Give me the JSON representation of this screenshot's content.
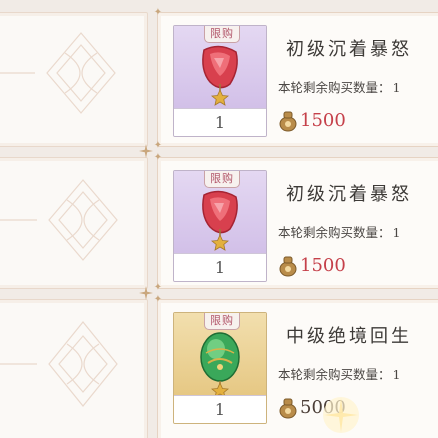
{
  "shop": {
    "items": [
      {
        "tag": "限购",
        "quantity": "1",
        "name": "初级沉着暴怒",
        "stock_label": "本轮剩余购买数量：",
        "stock_value": "1",
        "price": "1500",
        "rarity": "purple",
        "icon": "red-crystal-pendant-icon"
      },
      {
        "tag": "限购",
        "quantity": "1",
        "name": "初级沉着暴怒",
        "stock_label": "本轮剩余购买数量：",
        "stock_value": "1",
        "price": "1500",
        "rarity": "purple",
        "icon": "red-crystal-pendant-icon"
      },
      {
        "tag": "限购",
        "quantity": "1",
        "name": "中级绝境回生",
        "stock_label": "本轮剩余购买数量：",
        "stock_value": "1",
        "price": "5000",
        "rarity": "gold",
        "icon": "green-dragon-egg-icon"
      }
    ]
  },
  "colors": {
    "background": "#f1ebe6",
    "price_red": "#c5404a",
    "price_dark": "#4a3d36",
    "tag_text": "#b2566a",
    "purple_bg": "#d2c0e8",
    "gold_bg": "#e6c884"
  }
}
